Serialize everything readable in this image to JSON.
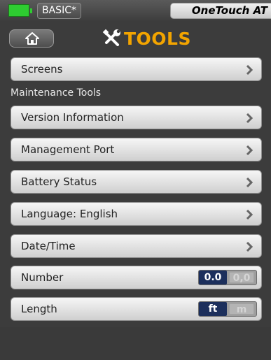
{
  "status": {
    "profile_label": "BASIC*",
    "device_name": "OneTouch AT",
    "battery_icon": "battery-full-icon",
    "battery_color": "#2ecc31"
  },
  "header": {
    "home_icon": "home-icon",
    "title_icon": "tools-icon",
    "title": "TOOLS",
    "title_color": "#f2a400"
  },
  "menu": {
    "screens": "Screens",
    "section_title": "Maintenance Tools",
    "version_information": "Version Information",
    "management_port": "Management Port",
    "battery_status": "Battery Status",
    "language": "Language: English",
    "date_time": "Date/Time",
    "number": {
      "label": "Number",
      "selected": "0.0",
      "other": "0,0"
    },
    "length": {
      "label": "Length",
      "selected": "ft",
      "other": "m"
    }
  },
  "colors": {
    "toggle_selected": "#1c2f5c",
    "background": "#3c3c3c"
  }
}
